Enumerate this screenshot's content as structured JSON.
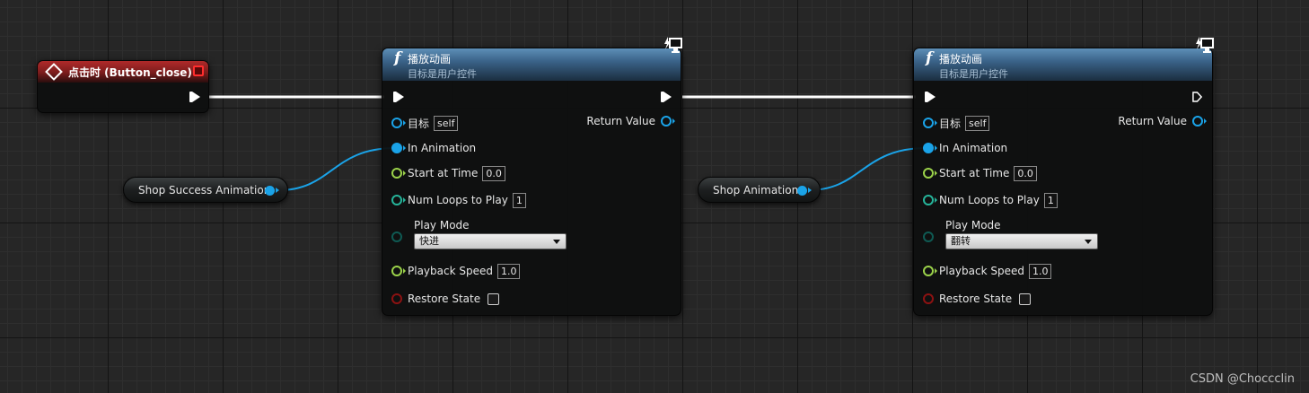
{
  "event_node": {
    "title": "点击时 (Button_close)"
  },
  "variables": [
    {
      "label": "Shop Success Animation"
    },
    {
      "label": "Shop Animation"
    }
  ],
  "function_nodes": [
    {
      "title": "播放动画",
      "subtitle": "目标是用户控件",
      "pins": {
        "target_label": "目标",
        "target_value": "self",
        "in_animation": "In Animation",
        "start_at_time": "Start at Time",
        "start_at_time_value": "0.0",
        "num_loops": "Num Loops to Play",
        "num_loops_value": "1",
        "play_mode": "Play Mode",
        "play_mode_value": "快进",
        "playback_speed": "Playback Speed",
        "playback_speed_value": "1.0",
        "restore_state": "Restore State",
        "return_value": "Return Value"
      }
    },
    {
      "title": "播放动画",
      "subtitle": "目标是用户控件",
      "pins": {
        "target_label": "目标",
        "target_value": "self",
        "in_animation": "In Animation",
        "start_at_time": "Start at Time",
        "start_at_time_value": "0.0",
        "num_loops": "Num Loops to Play",
        "num_loops_value": "1",
        "play_mode": "Play Mode",
        "play_mode_value": "翻转",
        "playback_speed": "Playback Speed",
        "playback_speed_value": "1.0",
        "restore_state": "Restore State",
        "return_value": "Return Value"
      }
    }
  ],
  "watermark": "CSDN @Choccclin",
  "colors": {
    "object_pin": "#1aa3e8",
    "float_pin": "#9bd24a",
    "int_pin": "#26b49a",
    "bool_pin": "#8c1212",
    "event_header": "#b02a2a",
    "function_header": "#3a6288"
  }
}
